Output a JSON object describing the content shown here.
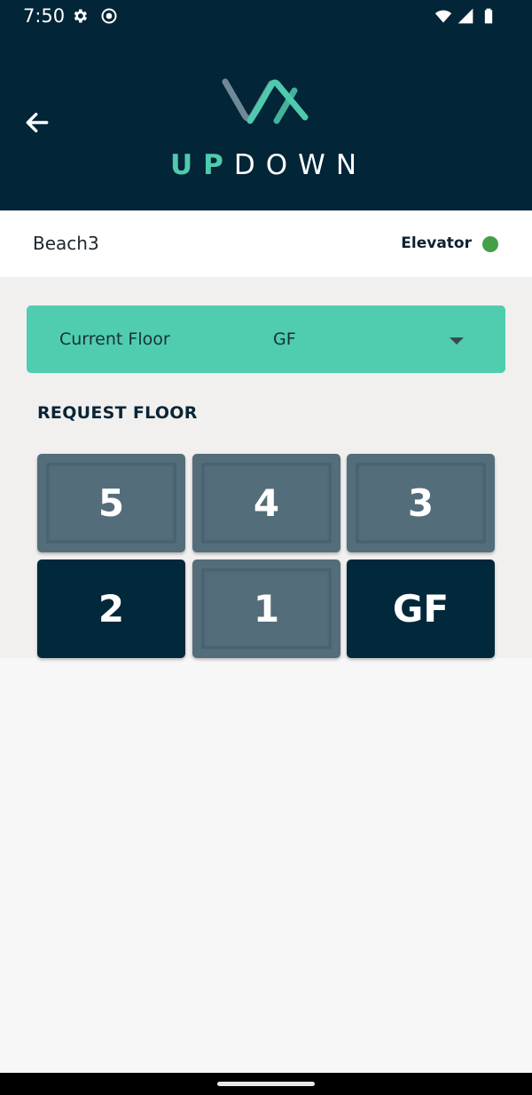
{
  "status_bar": {
    "time": "7:50",
    "icons": [
      "gear-icon",
      "record-icon",
      "wifi-icon",
      "signal-icon",
      "battery-icon"
    ]
  },
  "header": {
    "brand_up": "UP",
    "brand_down": "DOWN",
    "back_icon": "arrow-left-icon",
    "colors": {
      "background": "#022537",
      "accent": "#4fcaad"
    }
  },
  "info": {
    "name": "Beach3",
    "type_label": "Elevator",
    "status_color": "#43a047"
  },
  "current_floor": {
    "label": "Current Floor",
    "value": "GF"
  },
  "request": {
    "title": "REQUEST FLOOR",
    "floors": [
      {
        "label": "5",
        "active": false
      },
      {
        "label": "4",
        "active": false
      },
      {
        "label": "3",
        "active": false
      },
      {
        "label": "2",
        "active": true
      },
      {
        "label": "1",
        "active": false
      },
      {
        "label": "GF",
        "active": true
      }
    ]
  }
}
